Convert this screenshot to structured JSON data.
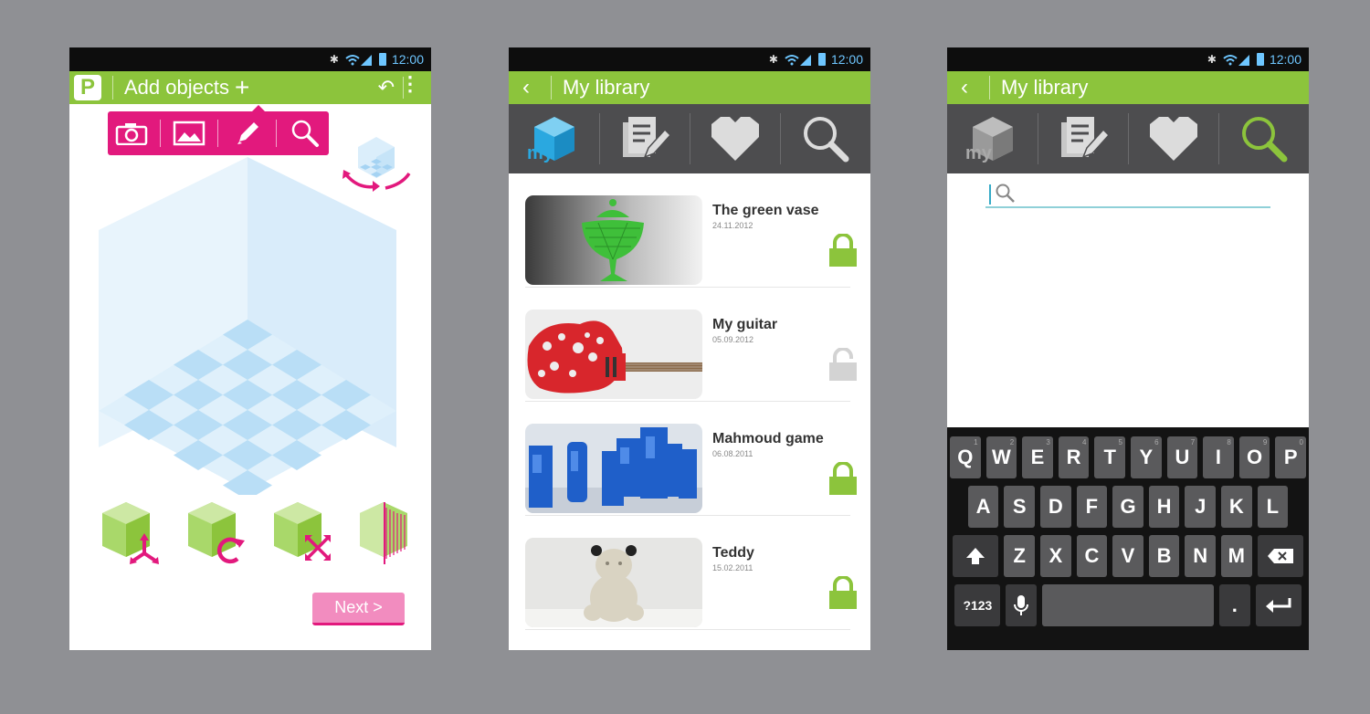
{
  "status": {
    "time": "12:00"
  },
  "screen1": {
    "title": "Add objects",
    "logo": "P",
    "next_label": "Next >",
    "icons": [
      "camera-icon",
      "image-icon",
      "pencil-icon",
      "search-icon"
    ],
    "colors": {
      "accent": "#e2197d",
      "brand": "#8cc43c"
    }
  },
  "screen2": {
    "title": "My library",
    "tabs": {
      "my_label": "my"
    },
    "items": [
      {
        "name": "The green vase",
        "date": "24.11.2012",
        "locked": true
      },
      {
        "name": "My guitar",
        "date": "05.09.2012",
        "locked": false
      },
      {
        "name": "Mahmoud game",
        "date": "06.08.2011",
        "locked": true
      },
      {
        "name": "Teddy",
        "date": "15.02.2011",
        "locked": true
      }
    ]
  },
  "screen3": {
    "title": "My library",
    "tabs": {
      "my_label": "my"
    },
    "search": {
      "value": ""
    },
    "keyboard": {
      "row1": [
        "Q",
        "W",
        "E",
        "R",
        "T",
        "Y",
        "U",
        "I",
        "O",
        "P"
      ],
      "row1_hints": [
        "1",
        "2",
        "3",
        "4",
        "5",
        "6",
        "7",
        "8",
        "9",
        "0"
      ],
      "row2": [
        "A",
        "S",
        "D",
        "F",
        "G",
        "H",
        "J",
        "K",
        "L"
      ],
      "row3": [
        "Z",
        "X",
        "C",
        "V",
        "B",
        "N",
        "M"
      ],
      "symbols_label": "?123",
      "period_label": "."
    }
  }
}
